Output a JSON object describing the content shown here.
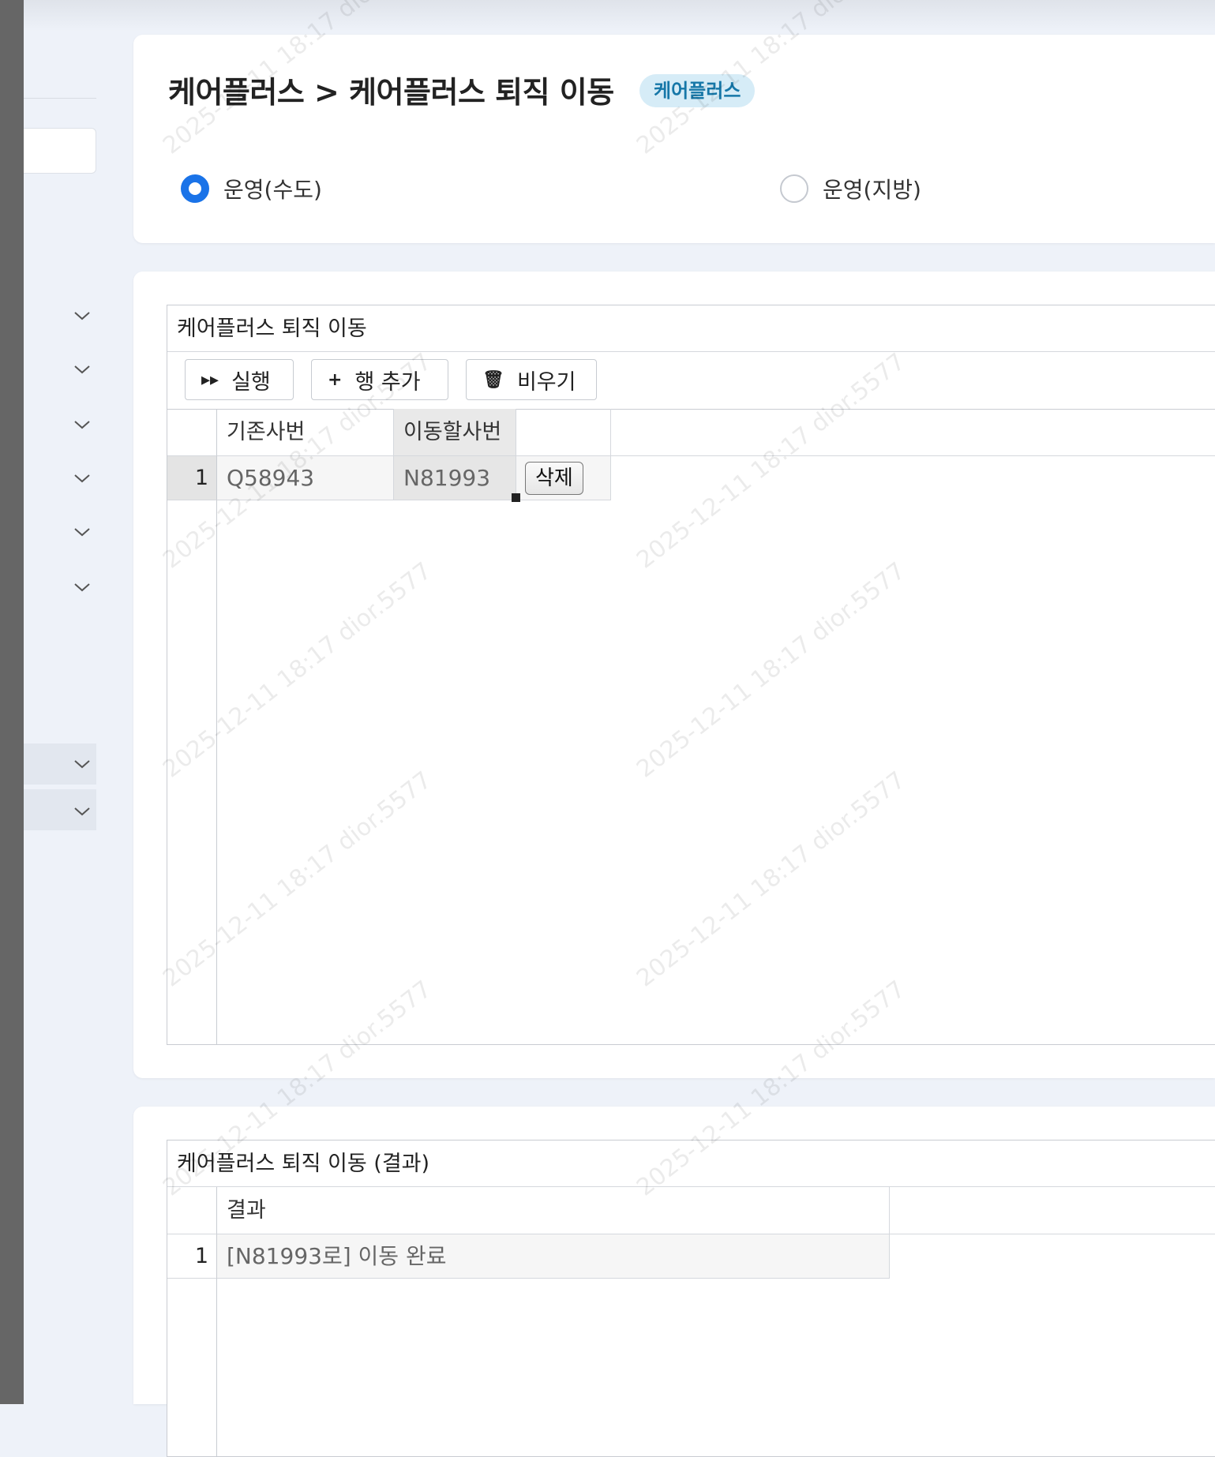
{
  "header": {
    "title": "케어플러스 > 케어플러스 퇴직 이동",
    "badge": "케어플러스"
  },
  "radio_options": [
    {
      "label": "운영(수도)",
      "selected": true
    },
    {
      "label": "운영(지방)",
      "selected": false
    }
  ],
  "main_panel": {
    "title": "케어플러스 퇴직 이동",
    "toolbar": {
      "run_label": "실행",
      "add_row_label": "행 추가",
      "clear_label": "비우기"
    },
    "columns": [
      "기존사번",
      "이동할사번"
    ],
    "rows": [
      {
        "num": "1",
        "old_id": "Q58943",
        "new_id": "N81993",
        "delete_label": "삭제"
      }
    ]
  },
  "result_panel": {
    "title": "케어플러스 퇴직 이동 (결과)",
    "columns": [
      "결과"
    ],
    "rows": [
      {
        "num": "1",
        "result": "[N81993로] 이동 완료"
      }
    ]
  },
  "watermark": "2025-12-11 18:17 dior.5577",
  "colors": {
    "accent": "#1a73e8",
    "badge_bg": "#d6ecf7",
    "badge_text": "#1677a8",
    "page_bg": "#eef2f9"
  }
}
